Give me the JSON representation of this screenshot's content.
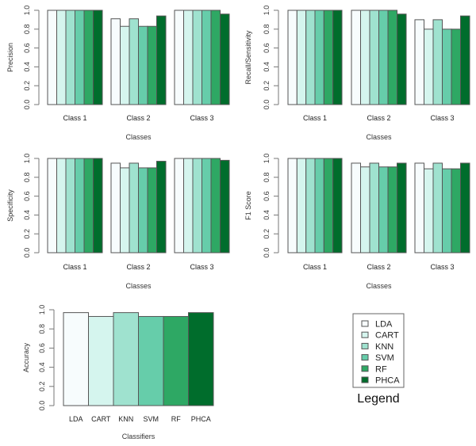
{
  "classifiers": [
    "LDA",
    "CART",
    "KNN",
    "SVM",
    "RF",
    "PHCA"
  ],
  "colors": {
    "LDA": "#F7FCFD",
    "CART": "#D5F5EE",
    "KNN": "#9FE2CF",
    "SVM": "#66CDAA",
    "RF": "#2EA864",
    "PHCA": "#006D2C",
    "bar_stroke": "#555555",
    "axis": "#777777"
  },
  "legend": {
    "title": "Legend",
    "entries": [
      "LDA",
      "CART",
      "KNN",
      "SVM",
      "RF",
      "PHCA"
    ]
  },
  "chart_data": [
    {
      "type": "bar",
      "id": "precision",
      "ylabel": "Precision",
      "xlabel": "Classes",
      "ylim": [
        0,
        1
      ],
      "yticks": [
        "0.0",
        "0.2",
        "0.4",
        "0.6",
        "0.8",
        "1.0"
      ],
      "categories": [
        "Class 1",
        "Class 2",
        "Class 3"
      ],
      "series": [
        {
          "name": "LDA",
          "values": [
            1.0,
            0.91,
            1.0
          ]
        },
        {
          "name": "CART",
          "values": [
            1.0,
            0.83,
            1.0
          ]
        },
        {
          "name": "KNN",
          "values": [
            1.0,
            0.91,
            1.0
          ]
        },
        {
          "name": "SVM",
          "values": [
            1.0,
            0.83,
            1.0
          ]
        },
        {
          "name": "RF",
          "values": [
            1.0,
            0.83,
            1.0
          ]
        },
        {
          "name": "PHCA",
          "values": [
            1.0,
            0.94,
            0.96
          ]
        }
      ]
    },
    {
      "type": "bar",
      "id": "recall",
      "ylabel": "Recall/Sensitivity",
      "xlabel": "Classes",
      "ylim": [
        0,
        1
      ],
      "yticks": [
        "0.0",
        "0.2",
        "0.4",
        "0.6",
        "0.8",
        "1.0"
      ],
      "categories": [
        "Class 1",
        "Class 2",
        "Class 3"
      ],
      "series": [
        {
          "name": "LDA",
          "values": [
            1.0,
            1.0,
            0.9
          ]
        },
        {
          "name": "CART",
          "values": [
            1.0,
            1.0,
            0.8
          ]
        },
        {
          "name": "KNN",
          "values": [
            1.0,
            1.0,
            0.9
          ]
        },
        {
          "name": "SVM",
          "values": [
            1.0,
            1.0,
            0.8
          ]
        },
        {
          "name": "RF",
          "values": [
            1.0,
            1.0,
            0.8
          ]
        },
        {
          "name": "PHCA",
          "values": [
            1.0,
            0.96,
            0.94
          ]
        }
      ]
    },
    {
      "type": "bar",
      "id": "specificity",
      "ylabel": "Specificity",
      "xlabel": "Classes",
      "ylim": [
        0,
        1
      ],
      "yticks": [
        "0.0",
        "0.2",
        "0.4",
        "0.6",
        "0.8",
        "1.0"
      ],
      "categories": [
        "Class 1",
        "Class 2",
        "Class 3"
      ],
      "series": [
        {
          "name": "LDA",
          "values": [
            1.0,
            0.95,
            1.0
          ]
        },
        {
          "name": "CART",
          "values": [
            1.0,
            0.9,
            1.0
          ]
        },
        {
          "name": "KNN",
          "values": [
            1.0,
            0.95,
            1.0
          ]
        },
        {
          "name": "SVM",
          "values": [
            1.0,
            0.9,
            1.0
          ]
        },
        {
          "name": "RF",
          "values": [
            1.0,
            0.9,
            1.0
          ]
        },
        {
          "name": "PHCA",
          "values": [
            1.0,
            0.97,
            0.98
          ]
        }
      ]
    },
    {
      "type": "bar",
      "id": "f1",
      "ylabel": "F1 Score",
      "xlabel": "Classes",
      "ylim": [
        0,
        1
      ],
      "yticks": [
        "0.0",
        "0.2",
        "0.4",
        "0.6",
        "0.8",
        "1.0"
      ],
      "categories": [
        "Class 1",
        "Class 2",
        "Class 3"
      ],
      "series": [
        {
          "name": "LDA",
          "values": [
            1.0,
            0.95,
            0.95
          ]
        },
        {
          "name": "CART",
          "values": [
            1.0,
            0.91,
            0.89
          ]
        },
        {
          "name": "KNN",
          "values": [
            1.0,
            0.95,
            0.95
          ]
        },
        {
          "name": "SVM",
          "values": [
            1.0,
            0.91,
            0.89
          ]
        },
        {
          "name": "RF",
          "values": [
            1.0,
            0.91,
            0.89
          ]
        },
        {
          "name": "PHCA",
          "values": [
            1.0,
            0.95,
            0.95
          ]
        }
      ]
    },
    {
      "type": "bar",
      "id": "accuracy",
      "ylabel": "Accuracy",
      "xlabel": "Classifiers",
      "ylim": [
        0,
        1
      ],
      "yticks": [
        "0.0",
        "0.2",
        "0.4",
        "0.6",
        "0.8",
        "1.0"
      ],
      "categories": [
        "LDA",
        "CART",
        "KNN",
        "SVM",
        "RF",
        "PHCA"
      ],
      "values": [
        0.97,
        0.93,
        0.97,
        0.93,
        0.93,
        0.97
      ]
    }
  ]
}
